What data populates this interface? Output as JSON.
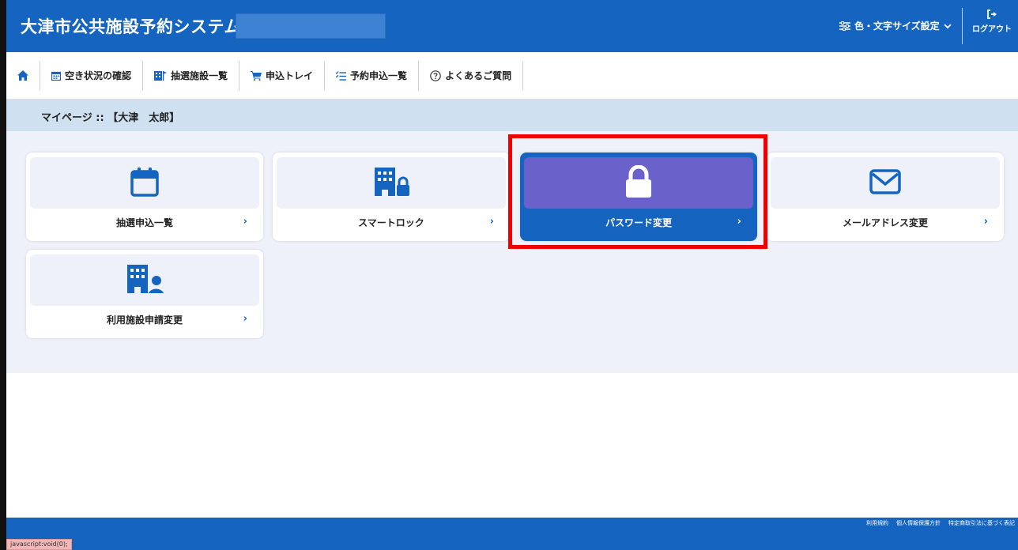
{
  "header": {
    "title": "大津市公共施設予約システム",
    "settings_label": "色・文字サイズ設定",
    "logout_label": "ログアウト"
  },
  "nav": {
    "items": [
      {
        "label": "空き状況の確認",
        "icon": "calendar-grid-icon"
      },
      {
        "label": "抽選施設一覧",
        "icon": "building-flag-icon"
      },
      {
        "label": "申込トレイ",
        "icon": "cart-icon"
      },
      {
        "label": "予約申込一覧",
        "icon": "list-icon"
      },
      {
        "label": "よくあるご質問",
        "icon": "question-circle-icon"
      }
    ]
  },
  "breadcrumb": {
    "title": "マイページ :: 【大津　太郎】"
  },
  "menu": {
    "cards": [
      {
        "label": "抽選申込一覧",
        "icon": "calendar-icon",
        "chevron": "›",
        "active": false
      },
      {
        "label": "スマートロック",
        "icon": "building-lock-icon",
        "chevron": "›",
        "active": false
      },
      {
        "label": "パスワード変更",
        "icon": "lock-icon",
        "chevron": "›",
        "active": true
      },
      {
        "label": "メールアドレス変更",
        "icon": "envelope-icon",
        "chevron": "›",
        "active": false
      },
      {
        "label": "利用施設申請変更",
        "icon": "building-user-icon",
        "chevron": "›",
        "active": false
      }
    ]
  },
  "footer": {
    "links": [
      "利用規約",
      "個人情報保護方針",
      "特定商取引法に基づく表記"
    ]
  },
  "status_bar": {
    "text": "javascript:void(0);"
  },
  "colors": {
    "primary": "#1565c0",
    "active_icon_bg": "#6a61cb",
    "band": "#cfe0f1",
    "content_bg": "#eef0fa",
    "highlight": "#ee0000"
  }
}
